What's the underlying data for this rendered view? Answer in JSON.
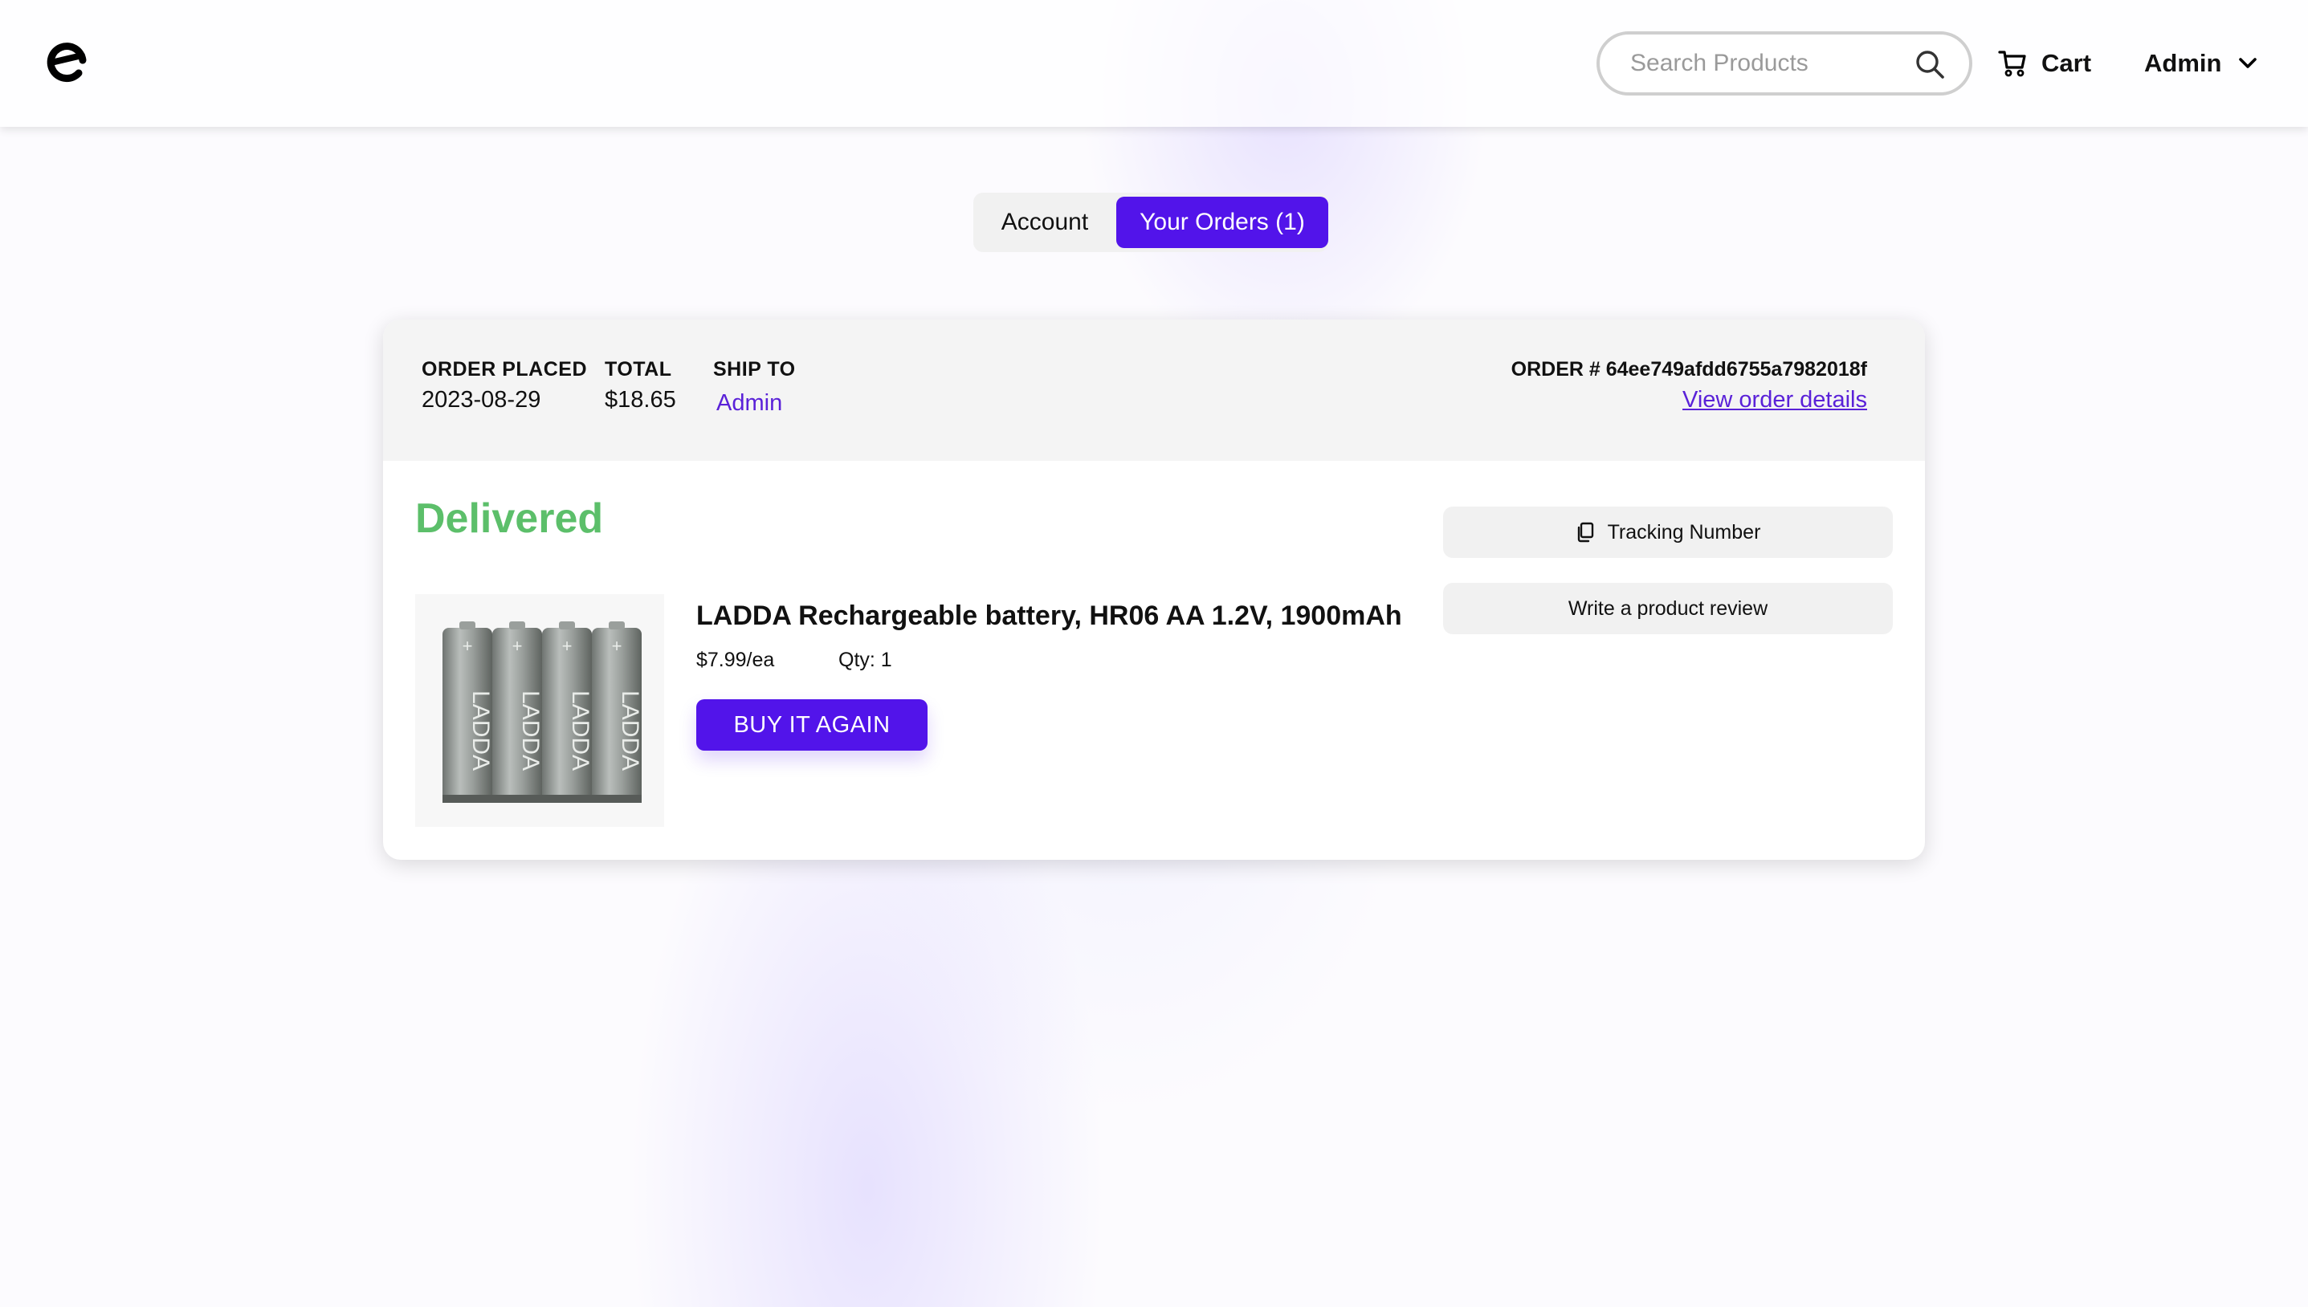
{
  "header": {
    "logo_icon": "brand-e-logo",
    "search": {
      "placeholder": "Search Products",
      "value": "",
      "icon": "search-icon"
    },
    "cart": {
      "label": "Cart",
      "icon": "cart-icon"
    },
    "user": {
      "label": "Admin",
      "icon": "chevron-down-icon"
    }
  },
  "tabs": [
    {
      "label": "Account",
      "active": false
    },
    {
      "label": "Your Orders (1)",
      "active": true
    }
  ],
  "order": {
    "placed_label": "ORDER PLACED",
    "placed_value": "2023-08-29",
    "total_label": "TOTAL",
    "total_value": "$18.65",
    "ship_label": "SHIP TO",
    "ship_value": "Admin",
    "order_number": "ORDER # 64ee749afdd6755a7982018f",
    "details_link": "View order details",
    "status": "Delivered",
    "item": {
      "name": "LADDA Rechargeable battery, HR06 AA 1.2V, 1900mAh",
      "price": "$7.99/ea",
      "qty": "Qty: 1",
      "buy_again": "BUY IT AGAIN",
      "image_text": "LADDA"
    },
    "actions": {
      "tracking": "Tracking Number",
      "tracking_icon": "copy-icon",
      "review": "Write a product review"
    }
  },
  "colors": {
    "accent": "#5214ea",
    "link": "#5a21d8",
    "status_delivered": "#5cbf6a"
  }
}
